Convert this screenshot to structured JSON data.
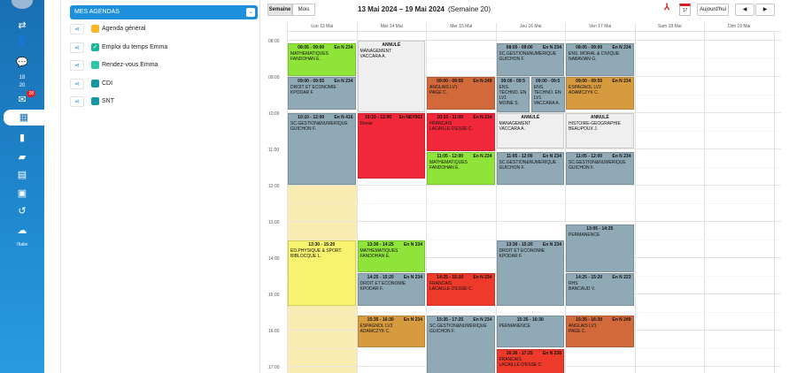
{
  "rail": {
    "items": [
      {
        "name": "settings-sliders-icon",
        "glyph": "⇄"
      },
      {
        "name": "user-icon",
        "glyph": "👤"
      },
      {
        "name": "chat-icon",
        "glyph": "💬"
      },
      {
        "name": "grades-icon",
        "glyph": "18/20",
        "text": "18\n20"
      },
      {
        "name": "mail-icon",
        "glyph": "✉",
        "badge": "28"
      },
      {
        "name": "calendar-icon",
        "glyph": "▦",
        "active": true
      },
      {
        "name": "notebook-icon",
        "glyph": "▮"
      },
      {
        "name": "books-icon",
        "glyph": "▰"
      },
      {
        "name": "document-icon",
        "glyph": "▤"
      },
      {
        "name": "contact-card-icon",
        "glyph": "▣"
      },
      {
        "name": "history-icon",
        "glyph": "↺"
      },
      {
        "name": "cloud-icon",
        "glyph": "☁"
      }
    ],
    "brand": "l'Italie"
  },
  "panel": {
    "title": "MES AGENDAS",
    "agendas": [
      {
        "label": "Agenda général",
        "color": "#f4b829",
        "checked": false
      },
      {
        "label": "Emploi du temps Emma",
        "color": "#1bb59c",
        "checked": true
      },
      {
        "label": "Rendez-vous Emma",
        "color": "#2ec4a6",
        "checked": false
      },
      {
        "label": "CDI",
        "color": "#1596a0",
        "checked": false
      },
      {
        "label": "SNT",
        "color": "#1596a0",
        "checked": false
      }
    ]
  },
  "toolbar": {
    "week_label": "Semaine",
    "month_label": "Mois",
    "range": "13 Mai 2024 – 19 Mai 2024",
    "week_number": "(Semaine 20)",
    "today_label": "Aujourd'hui",
    "calendar_day": "17",
    "prev": "◀",
    "next": "▶"
  },
  "days": [
    "Lun 13 Mai",
    "Mar 14 Mai",
    "Mer 15 Mai",
    "Jeu 16 Mai",
    "Ven 17 Mai",
    "Sam 18 Mai",
    "Dim 19 Mai"
  ],
  "hours": [
    "08:00",
    "09:00",
    "10:00",
    "11:00",
    "12:00",
    "13:00",
    "14:00",
    "15:00",
    "16:00",
    "17:00"
  ],
  "colors": {
    "green": "#8fe43a",
    "steel": "#8faab6",
    "white": "#efefef",
    "orange": "#d2693a",
    "red": "#f0283a",
    "redorange": "#ee3a2a",
    "gold": "#d79b3f",
    "yellow": "#f7f36e",
    "monday_band": "#f8ecb0"
  },
  "events": [
    {
      "day": 0,
      "start": "08:05",
      "end": "09:00",
      "time": "08:05 - 09:00",
      "room": "En N 234",
      "lines": [
        "MATHEMATIQUES",
        "FANDOHAN E."
      ],
      "color": "green"
    },
    {
      "day": 0,
      "start": "09:00",
      "end": "09:55",
      "time": "09:00 - 09:55",
      "room": "En N 234",
      "lines": [
        "DROIT ET ECONOMIE",
        "KPODAR F."
      ],
      "color": "steel"
    },
    {
      "day": 0,
      "start": "10:00",
      "end": "12:00",
      "time": "10:10 - 12:00",
      "room": "En N 416",
      "lines": [
        "SC.GESTION&NUMERIQUE",
        "GUICHON F."
      ],
      "color": "steel"
    },
    {
      "day": 0,
      "start": "13:30",
      "end": "15:20",
      "time": "13:30 - 15:20",
      "room": "",
      "lines": [
        "ED.PHYSIQUE & SPORT.",
        "BIBLOCQUE L."
      ],
      "color": "yellow"
    },
    {
      "day": 1,
      "start": "08:00",
      "end": "10:00",
      "time": "ANNULÉ",
      "room": "",
      "lines": [
        "MANAGEMENT",
        "VACCARA A."
      ],
      "color": "white"
    },
    {
      "day": 1,
      "start": "10:00",
      "end": "11:50",
      "time": "10:10 - 12:00",
      "room": "En NEY002",
      "lines": [
        "Devoir"
      ],
      "color": "red"
    },
    {
      "day": 1,
      "start": "13:30",
      "end": "14:25",
      "time": "13:30 - 14:25",
      "room": "En N 234",
      "lines": [
        "MATHEMATIQUES",
        "FANDOHAN E."
      ],
      "color": "green"
    },
    {
      "day": 1,
      "start": "14:25",
      "end": "15:20",
      "time": "14:25 - 15:20",
      "room": "En N 234",
      "lines": [
        "DROIT ET ECONOMIE",
        "KPODAR F."
      ],
      "color": "steel"
    },
    {
      "day": 1,
      "start": "15:35",
      "end": "16:30",
      "time": "15:35 - 16:30",
      "room": "En N 234",
      "lines": [
        "ESPAGNOL LV2",
        "ADAMCZYK C."
      ],
      "color": "gold"
    },
    {
      "day": 2,
      "start": "09:00",
      "end": "09:55",
      "time": "09:00 - 09:55",
      "room": "En N 249",
      "lines": [
        "ANGLAIS LV1",
        "PAGE C."
      ],
      "color": "orange"
    },
    {
      "day": 2,
      "start": "10:00",
      "end": "11:05",
      "time": "10:10 - 11:05",
      "room": "En N 234",
      "lines": [
        "FRANCAIS",
        "LACAILLE D'ESSE C."
      ],
      "color": "red"
    },
    {
      "day": 2,
      "start": "11:05",
      "end": "12:00",
      "time": "11:05 - 12:00",
      "room": "En N 234",
      "lines": [
        "MATHEMATIQUES",
        "FANDOHAN E."
      ],
      "color": "green"
    },
    {
      "day": 2,
      "start": "14:25",
      "end": "15:20",
      "time": "14:25 - 15:20",
      "room": "En N 234",
      "lines": [
        "FRANCAIS",
        "LACAILLE D'ESSE C."
      ],
      "color": "redorange"
    },
    {
      "day": 2,
      "start": "15:35",
      "end": "17:25",
      "time": "15:35 - 17:25",
      "room": "En N 234",
      "lines": [
        "SC.GESTION&NUMERIQUE",
        "GUICHON F."
      ],
      "color": "steel"
    },
    {
      "day": 3,
      "start": "08:05",
      "end": "09:00",
      "time": "08:05 - 09:00",
      "room": "En N 234",
      "lines": [
        "SC.GESTION&NUMERIQUE",
        "GUICHON F."
      ],
      "color": "steel"
    },
    {
      "day": 3,
      "start": "09:00",
      "end": "10:00",
      "half": 0,
      "time": "09:00 - 09:5",
      "room": "",
      "lines": [
        "ENS.",
        "TECHNO. EN",
        "LV1",
        "MOINE S."
      ],
      "color": "steel"
    },
    {
      "day": 3,
      "start": "09:00",
      "end": "10:00",
      "half": 1,
      "time": "09:00 - 09:5",
      "room": "",
      "lines": [
        "ENS.",
        "TECHNO. EN",
        "LV1",
        "VACCARA A."
      ],
      "color": "steel"
    },
    {
      "day": 3,
      "start": "10:00",
      "end": "11:00",
      "time": "ANNULÉ",
      "room": "",
      "lines": [
        "MANAGEMENT",
        "VACCARA A."
      ],
      "color": "white"
    },
    {
      "day": 3,
      "start": "11:05",
      "end": "12:00",
      "time": "11:05 - 12:00",
      "room": "En N 234",
      "lines": [
        "SC.GESTION&NUMERIQUE",
        "GUICHON F."
      ],
      "color": "steel"
    },
    {
      "day": 3,
      "start": "13:30",
      "end": "15:20",
      "time": "13:30 - 15:20",
      "room": "En N 234",
      "lines": [
        "DROIT ET ECONOMIE",
        "KPODAR F."
      ],
      "color": "steel"
    },
    {
      "day": 3,
      "start": "15:35",
      "end": "16:30",
      "time": "15:35 - 16:30",
      "room": "",
      "lines": [
        "PERMANENCE"
      ],
      "color": "steel"
    },
    {
      "day": 3,
      "start": "16:30",
      "end": "17:25",
      "time": "16:30 - 17:25",
      "room": "En N 238",
      "lines": [
        "FRANCAIS",
        "LACAILLE D'ESSE C."
      ],
      "color": "redorange"
    },
    {
      "day": 4,
      "start": "08:05",
      "end": "09:00",
      "time": "08:05 - 09:00",
      "room": "En N 234",
      "lines": [
        "ENS. MORAL & CIVIQUE",
        "NABAVIAN G."
      ],
      "color": "steel"
    },
    {
      "day": 4,
      "start": "09:00",
      "end": "09:55",
      "time": "09:00 - 09:55",
      "room": "En N 234",
      "lines": [
        "ESPAGNOL LV2",
        "ADAMCZYK C."
      ],
      "color": "gold"
    },
    {
      "day": 4,
      "start": "10:00",
      "end": "11:00",
      "time": "ANNULÉ",
      "room": "",
      "lines": [
        "HISTOIRE-GEOGRAPHIE",
        "BEAUPOUX J."
      ],
      "color": "white"
    },
    {
      "day": 4,
      "start": "11:05",
      "end": "12:00",
      "time": "11:05 - 12:00",
      "room": "En N 234",
      "lines": [
        "SC.GESTION&NUMERIQUE",
        "GUICHON F."
      ],
      "color": "steel"
    },
    {
      "day": 4,
      "start": "13:05",
      "end": "14:25",
      "time": "13:05 - 14:25",
      "room": "",
      "lines": [
        "PERMANENCE"
      ],
      "color": "steel"
    },
    {
      "day": 4,
      "start": "14:25",
      "end": "15:20",
      "time": "14:25 - 15:20",
      "room": "En N 223",
      "lines": [
        "RHS",
        "BANCAUD V."
      ],
      "color": "steel"
    },
    {
      "day": 4,
      "start": "15:35",
      "end": "16:30",
      "time": "15:35 - 16:30",
      "room": "En N 249",
      "lines": [
        "ANGLAIS LV1",
        "PAGE C."
      ],
      "color": "orange"
    }
  ]
}
